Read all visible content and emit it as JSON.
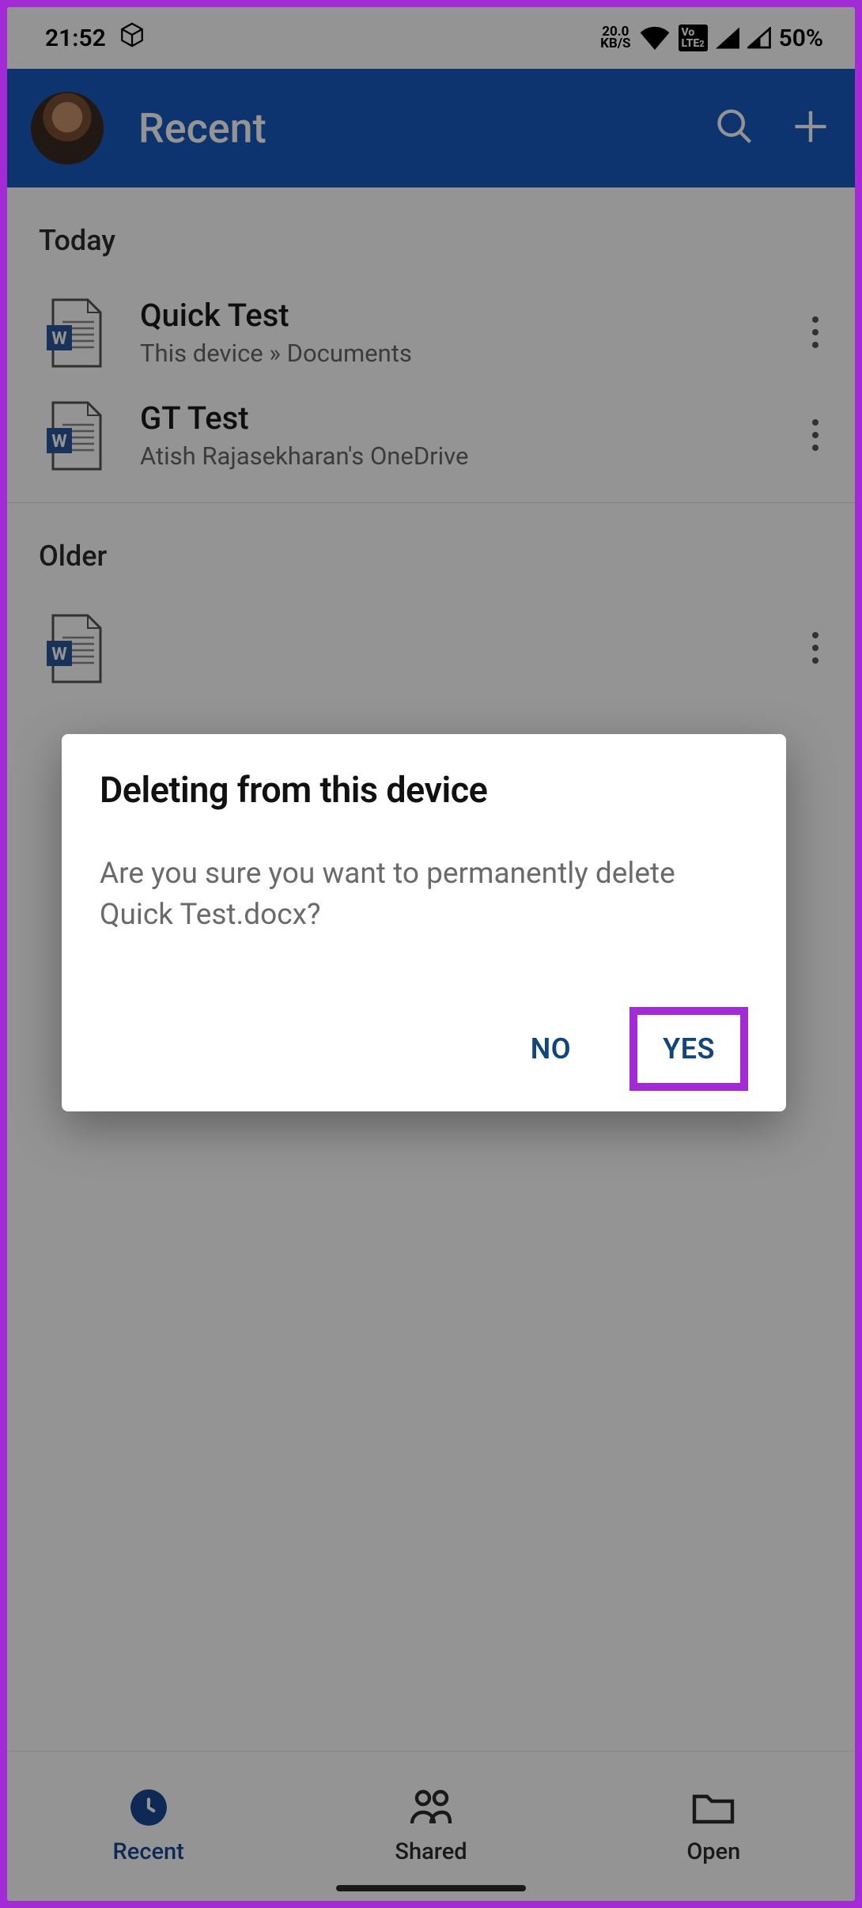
{
  "status": {
    "time": "21:52",
    "speed_value": "20.0",
    "speed_unit": "KB/S",
    "volte": "LTE 2",
    "battery": "50%"
  },
  "toolbar": {
    "title": "Recent"
  },
  "sections": [
    {
      "header": "Today",
      "files": [
        {
          "name": "Quick Test",
          "path": "This device » Documents"
        },
        {
          "name": "GT Test",
          "path": "Atish Rajasekharan's OneDrive"
        }
      ]
    },
    {
      "header": "Older",
      "files": [
        {
          "name": "",
          "path": ""
        }
      ]
    }
  ],
  "bottom_nav": {
    "items": [
      {
        "label": "Recent",
        "active": true
      },
      {
        "label": "Shared",
        "active": false
      },
      {
        "label": "Open",
        "active": false
      }
    ]
  },
  "dialog": {
    "title": "Deleting from this device",
    "message": "Are you sure you want to permanently delete Quick Test.docx?",
    "no": "NO",
    "yes": "YES"
  }
}
